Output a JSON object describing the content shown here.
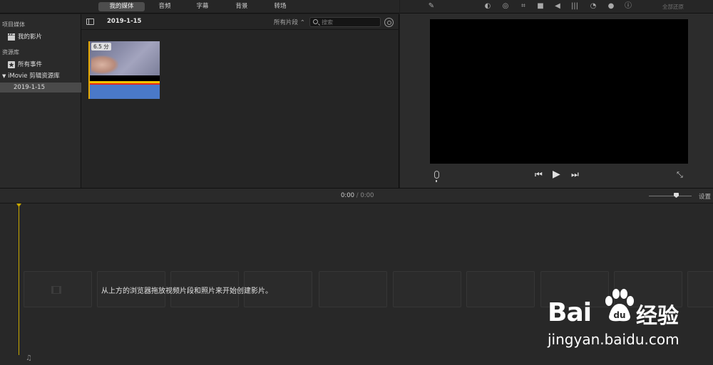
{
  "tabs": [
    "我的媒体",
    "音频",
    "字幕",
    "背景",
    "转场"
  ],
  "sidebar": {
    "project_header": "项目媒体",
    "project_item": "我的影片",
    "library_header": "资源库",
    "all_events": "所有事件",
    "library_name": "iMovie 剪辑资源库",
    "event": "2019-1-15"
  },
  "browser": {
    "title": "2019-1-15",
    "filter": "所有片段 ⌃",
    "search_placeholder": "搜索",
    "clip": {
      "duration": "6.5 分"
    }
  },
  "viewer": {
    "reset_all": "全部还原",
    "tool_icons": [
      "magic-wand-icon",
      "color-balance-icon",
      "color-correction-icon",
      "crop-icon",
      "stabilization-icon",
      "volume-icon",
      "noise-reduction-icon",
      "speed-icon",
      "clip-filter-icon",
      "info-icon"
    ]
  },
  "timeline": {
    "current_time": "0:00",
    "separator": "/",
    "total_time": "0:00",
    "settings": "设置",
    "hint": "从上方的浏览器拖放视频片段和照片来开始创建影片。"
  },
  "watermark": {
    "brand": "Bai",
    "brand_cn": "经验",
    "url": "jingyan.baidu.com"
  },
  "colors": {
    "accent_playhead": "#c9a800",
    "active_tab": "#4d4d4d",
    "selected_row": "#4a4a4a"
  }
}
